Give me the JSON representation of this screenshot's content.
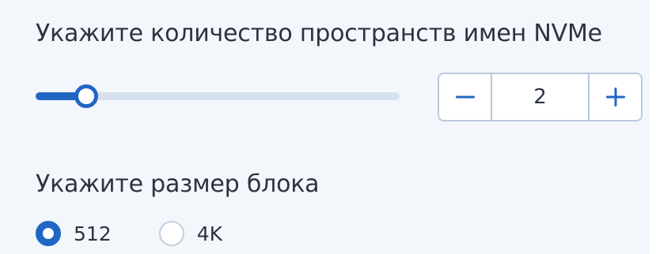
{
  "namespaces": {
    "label": "Укажите количество пространств имен NVMe",
    "slider": {
      "value": 2,
      "fill_fraction": 0.14
    },
    "stepper": {
      "value": "2",
      "decrement_icon": "minus-icon",
      "increment_icon": "plus-icon"
    }
  },
  "block_size": {
    "label": "Укажите размер блока",
    "options": [
      {
        "label": "512",
        "selected": true
      },
      {
        "label": "4K",
        "selected": false
      }
    ]
  },
  "colors": {
    "accent": "#2067c4",
    "track": "#d6e0ee",
    "border": "#b9c8dc",
    "panel_bg": "#f3f6fb",
    "text": "#2b3340"
  }
}
